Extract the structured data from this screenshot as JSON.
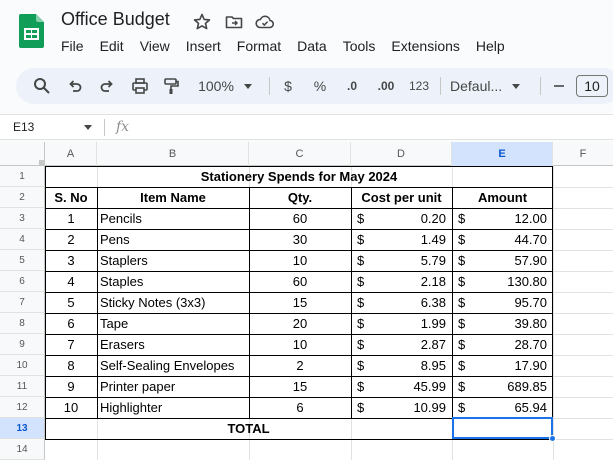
{
  "app": {
    "title": "Office Budget",
    "menu": [
      "File",
      "Edit",
      "View",
      "Insert",
      "Format",
      "Data",
      "Tools",
      "Extensions",
      "Help"
    ]
  },
  "toolbar": {
    "zoom": "100%",
    "currency": "$",
    "percent": "%",
    "decrease_decimal": ".0",
    "increase_decimal": ".00",
    "number_format": "123",
    "font": "Defaul...",
    "font_size": "10"
  },
  "formula_bar": {
    "name_box": "E13",
    "fx": "fx",
    "content": ""
  },
  "grid": {
    "columns": [
      "A",
      "B",
      "C",
      "D",
      "E",
      "F"
    ],
    "rows": [
      "1",
      "2",
      "3",
      "4",
      "5",
      "6",
      "7",
      "8",
      "9",
      "10",
      "11",
      "12",
      "13",
      "14"
    ],
    "active_column": "E",
    "active_row": "13"
  },
  "sheet": {
    "title": "Stationery Spends for May 2024",
    "headers": {
      "sno": "S. No",
      "item": "Item Name",
      "qty": "Qty.",
      "cost": "Cost per unit",
      "amount": "Amount"
    },
    "currency_symbol": "$",
    "items": [
      {
        "sno": "1",
        "item": "Pencils",
        "qty": "60",
        "cost": "0.20",
        "amount": "12.00"
      },
      {
        "sno": "2",
        "item": "Pens",
        "qty": "30",
        "cost": "1.49",
        "amount": "44.70"
      },
      {
        "sno": "3",
        "item": "Staplers",
        "qty": "10",
        "cost": "5.79",
        "amount": "57.90"
      },
      {
        "sno": "4",
        "item": "Staples",
        "qty": "60",
        "cost": "2.18",
        "amount": "130.80"
      },
      {
        "sno": "5",
        "item": "Sticky Notes (3x3)",
        "qty": "15",
        "cost": "6.38",
        "amount": "95.70"
      },
      {
        "sno": "6",
        "item": "Tape",
        "qty": "20",
        "cost": "1.99",
        "amount": "39.80"
      },
      {
        "sno": "7",
        "item": "Erasers",
        "qty": "10",
        "cost": "2.87",
        "amount": "28.70"
      },
      {
        "sno": "8",
        "item": "Self-Sealing Envelopes",
        "qty": "2",
        "cost": "8.95",
        "amount": "17.90"
      },
      {
        "sno": "9",
        "item": "Printer paper",
        "qty": "15",
        "cost": "45.99",
        "amount": "689.85"
      },
      {
        "sno": "10",
        "item": "Highlighter",
        "qty": "6",
        "cost": "10.99",
        "amount": "65.94"
      }
    ],
    "total_label": "TOTAL",
    "total_value": ""
  },
  "colors": {
    "accent": "#1a73e8",
    "sheets_green": "#0f9d58",
    "active_header_bg": "#d3e3fd"
  }
}
